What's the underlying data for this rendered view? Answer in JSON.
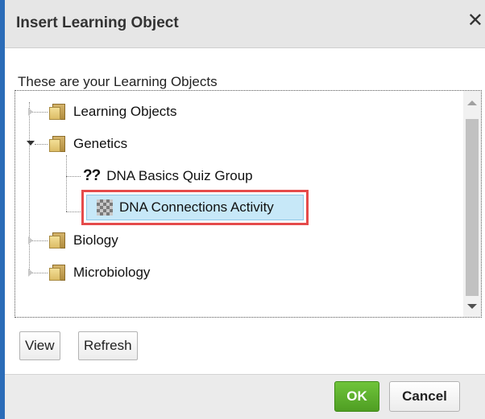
{
  "dialog": {
    "title": "Insert Learning Object",
    "close_glyph": "✕"
  },
  "intro_text": "These are your Learning Objects",
  "tree": {
    "items": [
      {
        "label": "Learning Objects",
        "icon": "folder-icon",
        "expander": "collapsed"
      },
      {
        "label": "Genetics",
        "icon": "folder-icon",
        "expander": "expanded"
      },
      {
        "label": "DNA Basics Quiz Group",
        "icon": "quiz-group-icon"
      },
      {
        "label": "DNA Connections Activity",
        "icon": "activity-icon",
        "selected": true
      },
      {
        "label": "Biology",
        "icon": "folder-icon",
        "expander": "collapsed"
      },
      {
        "label": "Microbiology",
        "icon": "folder-icon",
        "expander": "collapsed"
      }
    ],
    "quiz_icon_glyph": "??"
  },
  "buttons": {
    "view": "View",
    "refresh": "Refresh",
    "ok": "OK",
    "cancel": "Cancel"
  },
  "colors": {
    "selection_bg": "#c7e8f8",
    "highlight_border": "#e54b4b",
    "ok_button": "#5cb52d",
    "window_accent": "#2b6cb8"
  }
}
